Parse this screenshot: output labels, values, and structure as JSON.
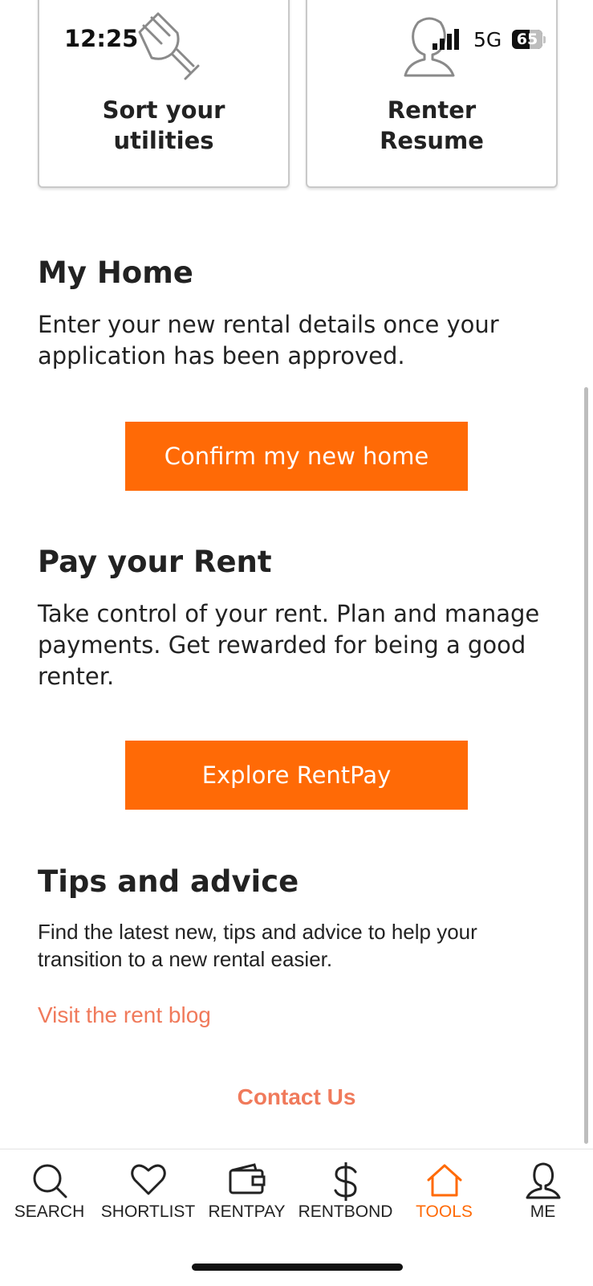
{
  "status_bar": {
    "time": "12:25",
    "network": "5G",
    "battery": "65"
  },
  "cards": [
    {
      "label": "Sort your utilities",
      "line1": "Sort your",
      "line2": "utilities",
      "icon": "plug-icon"
    },
    {
      "label": "Renter Resume",
      "line1": "Renter",
      "line2": "Resume",
      "icon": "person-icon"
    }
  ],
  "my_home": {
    "title": "My Home",
    "description": "Enter your new rental details once your application has been approved.",
    "button": "Confirm my new home"
  },
  "pay_rent": {
    "title": "Pay your Rent",
    "description": "Take control of your rent. Plan and manage payments. Get rewarded for being a good renter.",
    "button": "Explore RentPay"
  },
  "tips": {
    "title": "Tips and advice",
    "description": "Find the latest new, tips and advice to help your transition to a new rental easier.",
    "link": "Visit the rent blog"
  },
  "contact": "Contact Us",
  "tabbar": {
    "active": "TOOLS",
    "accent_color": "#ff6a06",
    "items": [
      {
        "label": "SEARCH",
        "icon": "search-icon"
      },
      {
        "label": "SHORTLIST",
        "icon": "heart-icon"
      },
      {
        "label": "RENTPAY",
        "icon": "wallet-icon"
      },
      {
        "label": "RENTBOND",
        "icon": "dollar-icon"
      },
      {
        "label": "TOOLS",
        "icon": "home-icon"
      },
      {
        "label": "ME",
        "icon": "person-icon"
      }
    ]
  }
}
